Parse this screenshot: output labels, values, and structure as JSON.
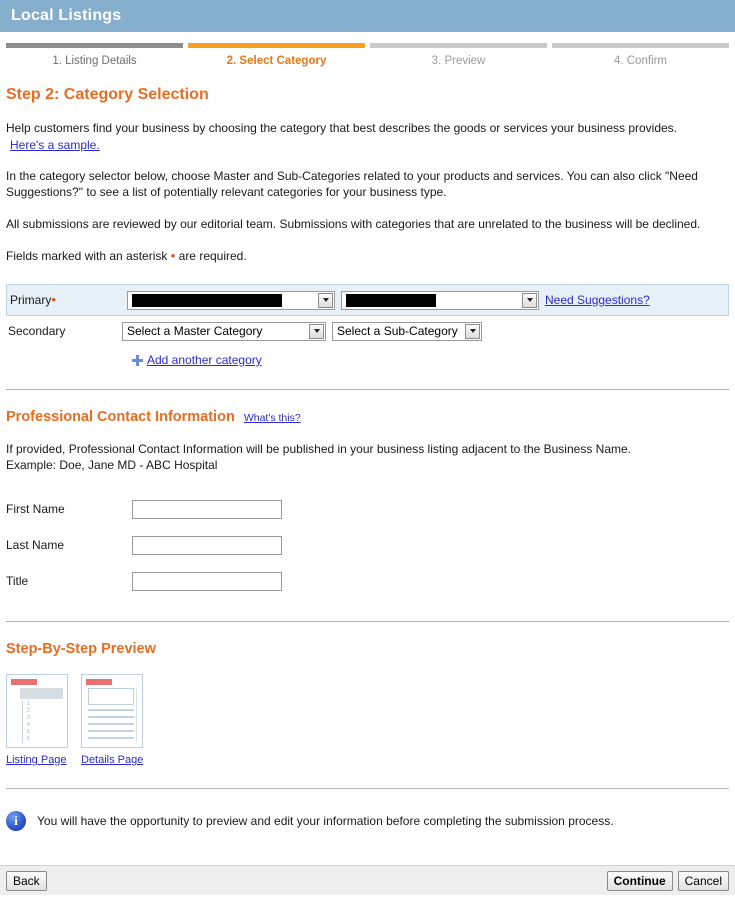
{
  "header": {
    "title": "Local Listings"
  },
  "steps": [
    {
      "label": "1. Listing Details",
      "state": "done"
    },
    {
      "label": "2. Select Category",
      "state": "active"
    },
    {
      "label": "3. Preview",
      "state": "upcoming"
    },
    {
      "label": "4. Confirm",
      "state": "upcoming"
    }
  ],
  "page_title": "Step 2: Category Selection",
  "intro": {
    "paragraph1": "Help customers find your business by choosing the category that best describes the goods or services your business provides.",
    "sample_link": "Here's a sample.",
    "paragraph2": "In the category selector below, choose Master and Sub-Categories related to your products and services. You can also click \"Need Suggestions?\" to see a list of potentially relevant categories for your business type.",
    "paragraph3": "All submissions are reviewed by our editorial team. Submissions with categories that are unrelated to the business will be declined.",
    "required_note_before": "Fields marked with an asterisk",
    "required_star": "•",
    "required_note_after": "are required."
  },
  "category": {
    "primary_label": "Primary",
    "primary_star": "•",
    "secondary_label": "Secondary",
    "primary_master_value": "",
    "primary_sub_value": "",
    "secondary_master_value": "Select a Master Category",
    "secondary_sub_value": "Select a Sub-Category",
    "need_suggestions_link": "Need Suggestions?",
    "add_another_link": "Add another category"
  },
  "contact": {
    "section_title": "Professional Contact Information",
    "whats_this_link": "What's this?",
    "description_line1": "If provided, Professional Contact Information will be published in your business listing adjacent to the Business Name.",
    "description_line2": "Example: Doe, Jane MD - ABC Hospital",
    "fields": [
      {
        "label": "First Name",
        "value": ""
      },
      {
        "label": "Last Name",
        "value": ""
      },
      {
        "label": "Title",
        "value": ""
      }
    ]
  },
  "preview": {
    "section_title": "Step-By-Step Preview",
    "thumbs": [
      {
        "caption": "Listing Page",
        "rows": [
          "1",
          "2",
          "3",
          "4",
          "5",
          "6"
        ]
      },
      {
        "caption": "Details Page"
      }
    ]
  },
  "notice": {
    "text": "You will have the opportunity to preview and edit your information before completing the submission process."
  },
  "footer": {
    "back_label": "Back",
    "continue_label": "Continue",
    "cancel_label": "Cancel"
  },
  "colors": {
    "header_blue": "#84aecb",
    "accent_orange": "#ec6c1f",
    "step_active": "#f5a01e",
    "link_blue": "#2b2bd4",
    "highlight_row": "#e7f0f7"
  }
}
